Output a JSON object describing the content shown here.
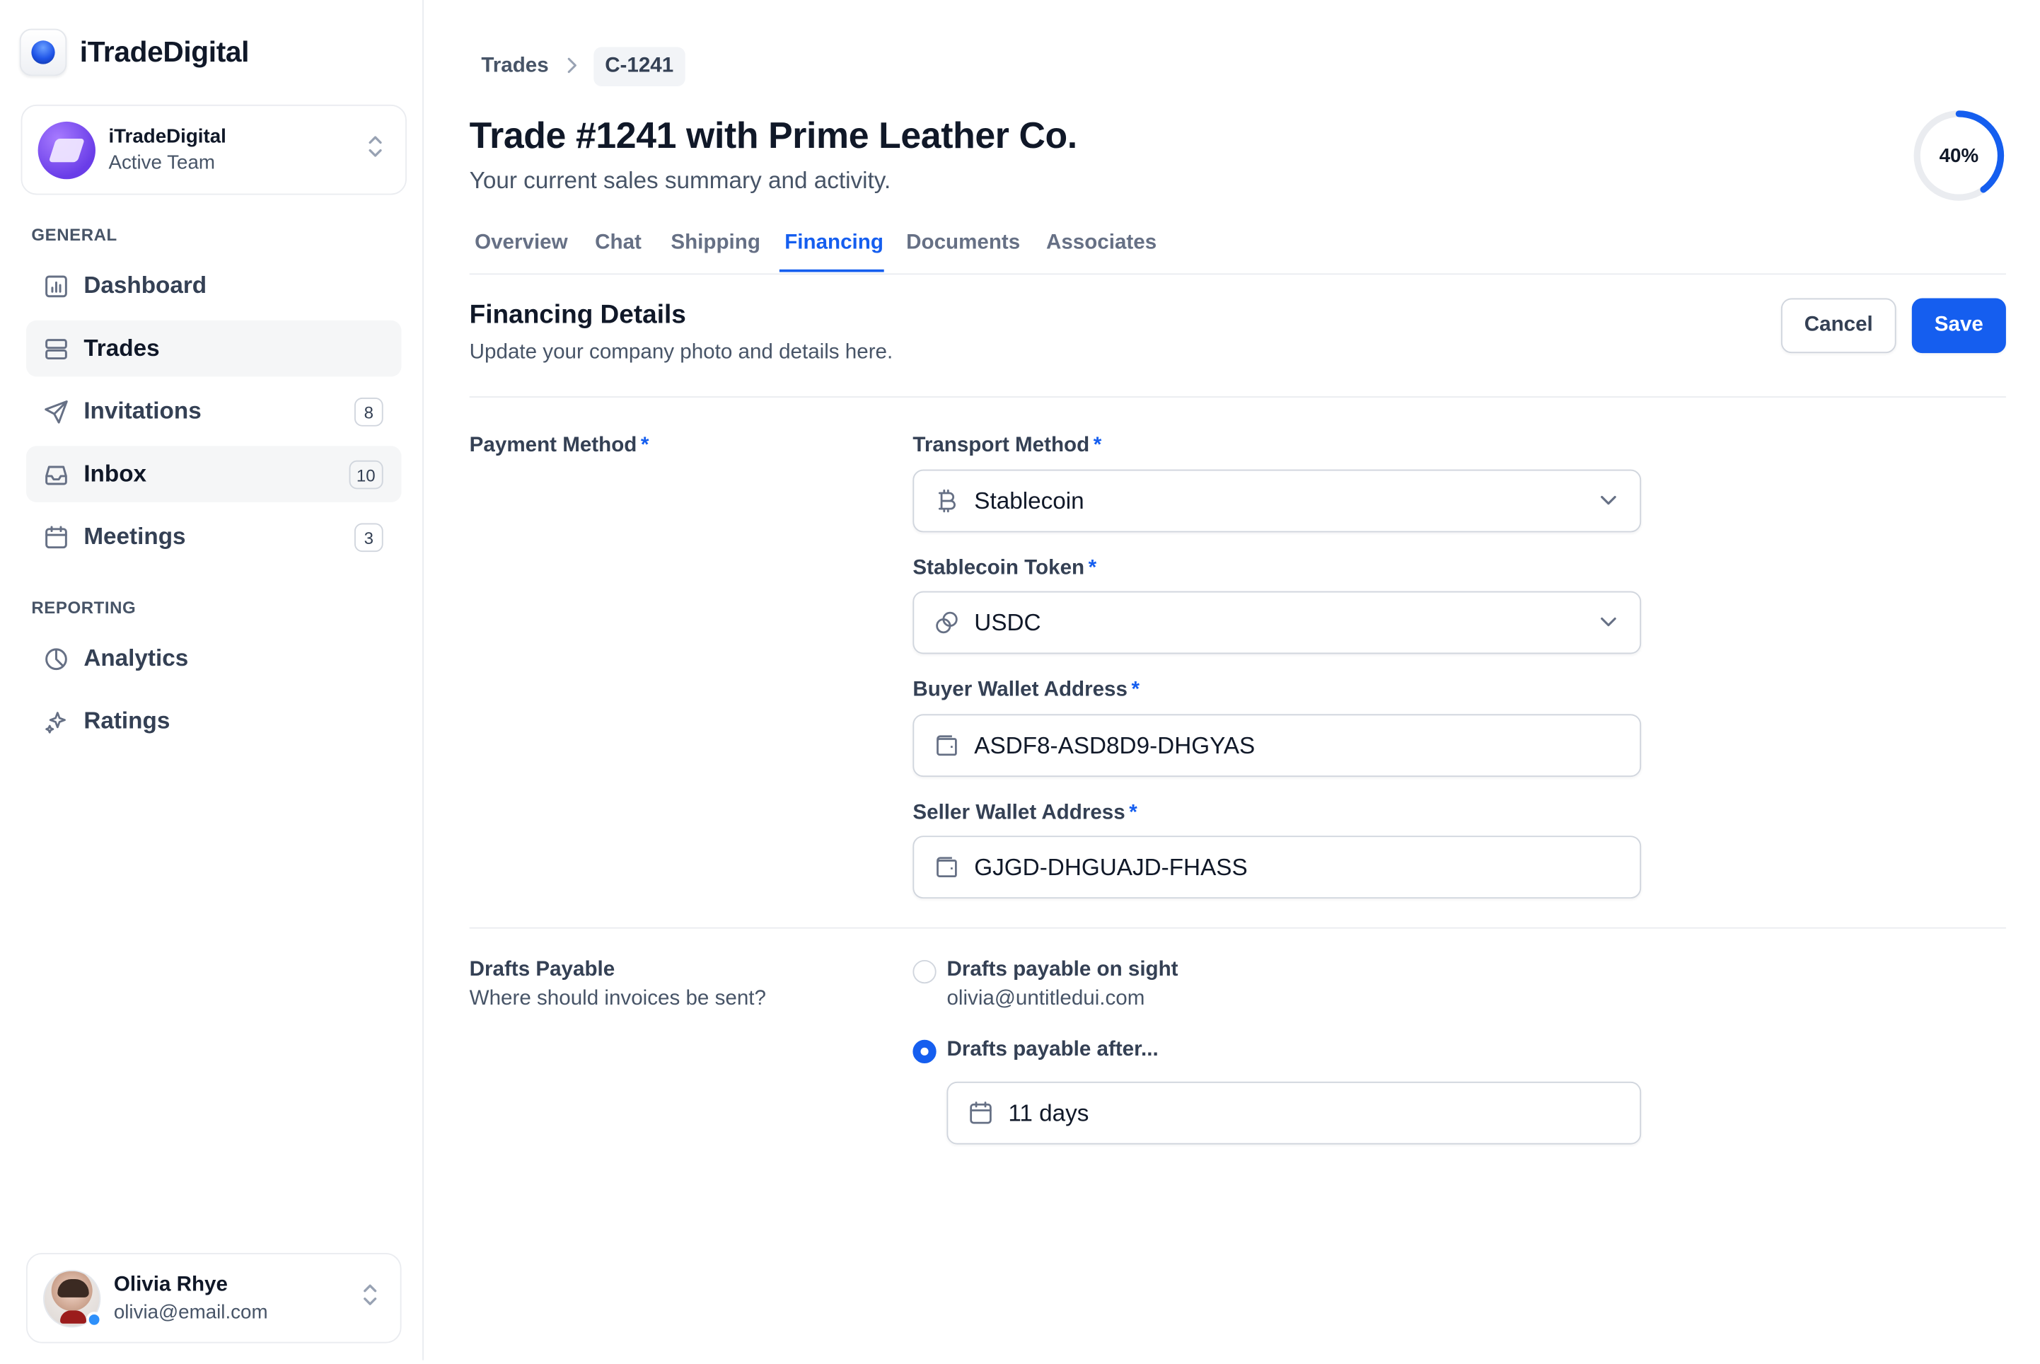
{
  "brand": {
    "name": "iTradeDigital"
  },
  "team": {
    "name": "iTradeDigital",
    "subtitle": "Active Team"
  },
  "sidebar": {
    "sections": [
      {
        "label": "GENERAL"
      },
      {
        "label": "REPORTING"
      }
    ],
    "items": [
      {
        "label": "Dashboard",
        "icon": "bar-chart-icon"
      },
      {
        "label": "Trades",
        "icon": "server-icon",
        "active": true
      },
      {
        "label": "Invitations",
        "icon": "send-icon",
        "badge": "8"
      },
      {
        "label": "Inbox",
        "icon": "inbox-icon",
        "badge": "10",
        "active": true
      },
      {
        "label": "Meetings",
        "icon": "calendar-icon",
        "badge": "3"
      },
      {
        "label": "Analytics",
        "icon": "pie-chart-icon"
      },
      {
        "label": "Ratings",
        "icon": "sparkles-icon"
      }
    ]
  },
  "user": {
    "name": "Olivia Rhye",
    "email": "olivia@email.com",
    "status_color": "#2e90fa"
  },
  "breadcrumb": {
    "parent": "Trades",
    "current": "C-1241"
  },
  "header": {
    "title": "Trade #1241 with Prime Leather Co.",
    "subtitle": "Your current sales summary and activity.",
    "progress_label": "40%",
    "progress_value": 0.4
  },
  "tabs": [
    {
      "label": "Overview"
    },
    {
      "label": "Chat"
    },
    {
      "label": "Shipping"
    },
    {
      "label": "Financing",
      "active": true
    },
    {
      "label": "Documents"
    },
    {
      "label": "Associates"
    }
  ],
  "section": {
    "title": "Financing Details",
    "subtitle": "Update your company photo and details here.",
    "cancel_label": "Cancel",
    "save_label": "Save"
  },
  "form": {
    "payment_method_label": "Payment Method",
    "required_mark": "*",
    "transport_method": {
      "label": "Transport Method",
      "value": "Stablecoin",
      "icon": "bitcoin-icon"
    },
    "stablecoin_token": {
      "label": "Stablecoin Token",
      "value": "USDC",
      "icon": "coins-icon"
    },
    "buyer_wallet": {
      "label": "Buyer Wallet Address",
      "value": "ASDF8-ASD8D9-DHGYAS",
      "icon": "wallet-icon"
    },
    "seller_wallet": {
      "label": "Seller Wallet Address",
      "value": "GJGD-DHGUAJD-FHASS",
      "icon": "wallet-icon"
    },
    "drafts": {
      "title": "Drafts Payable",
      "subtitle": "Where should invoices be sent?",
      "option_sight": {
        "label": "Drafts payable on sight",
        "sub": "olivia@untitledui.com",
        "checked": false
      },
      "option_after": {
        "label": "Drafts payable after...",
        "checked": true
      },
      "days_value": "11 days"
    }
  },
  "colors": {
    "accent": "#155eef",
    "border": "#d0d5dd",
    "muted": "#475467"
  }
}
